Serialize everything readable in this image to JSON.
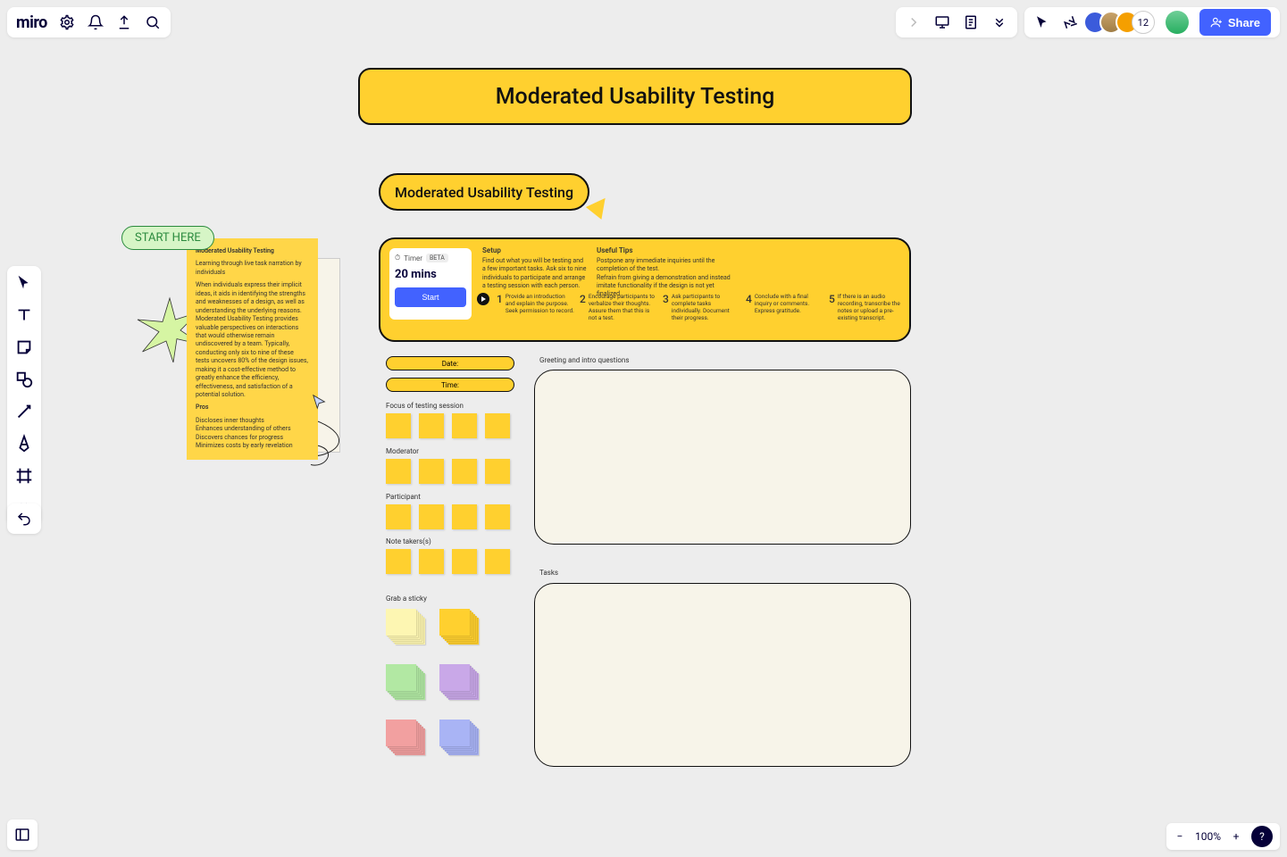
{
  "logo": "miro",
  "avatar_count": "12",
  "share_label": "Share",
  "zoom_level": "100%",
  "board": {
    "title": "Moderated Usability Testing",
    "subtitle": "Moderated Usability Testing",
    "start_here": "START HERE"
  },
  "info_card": {
    "heading": "Moderated Usability Testing",
    "p1": "Learning through live task narration by individuals",
    "p2": "When individuals express their implicit ideas, it aids in identifying the strengths and weaknesses of a design, as well as understanding the underlying reasons. Moderated Usability Testing provides valuable perspectives on interactions that would otherwise remain undiscovered by a team. Typically, conducting only six to nine of these tests uncovers 80% of the design issues, making it a cost-effective method to greatly enhance the efficiency, effectiveness, and satisfaction of a potential solution.",
    "pros_h": "Pros",
    "pros1": "Discloses inner thoughts",
    "pros2": "Enhances understanding of others",
    "pros3": "Discovers chances for progress",
    "pros4": "Minimizes costs by early revelation"
  },
  "timer": {
    "label": "Timer",
    "badge": "BETA",
    "value": "20 mins",
    "start": "Start"
  },
  "setup": {
    "h": "Setup",
    "body": "Find out what you will be testing and a few important tasks. Ask six to nine individuals to participate and arrange a testing session with each person."
  },
  "tips": {
    "h": "Useful Tips",
    "l1": "Postpone any immediate inquiries until the completion of the test.",
    "l2": "Refrain from giving a demonstration and instead imitate functionality if the design is not yet finalized."
  },
  "steps": {
    "s1": "Provide an introduction and explain the purpose. Seek permission to record.",
    "s2": "Encourage participants to verbalize their thoughts. Assure them that this is not a test.",
    "s3": "Ask participants to complete tasks individually. Document their progress.",
    "s4": "Conclude with a final inquiry or comments. Express gratitude.",
    "s5": "If there is an audio recording, transcribe the notes or upload a pre-existing transcript."
  },
  "fields": {
    "date": "Date:",
    "time": "Time:",
    "focus": "Focus of testing session",
    "moderator": "Moderator",
    "participant": "Participant",
    "notetaker": "Note takers(s)",
    "grab": "Grab a sticky",
    "greeting": "Greeting and intro questions",
    "tasks": "Tasks"
  },
  "sticky_colors": {
    "pale_yellow": "#fdf6b2",
    "yellow": "#ffd02f",
    "green": "#b2e8a3",
    "purple": "#c9a8e8",
    "red": "#f2a0a0",
    "blue": "#a9b4f5"
  }
}
